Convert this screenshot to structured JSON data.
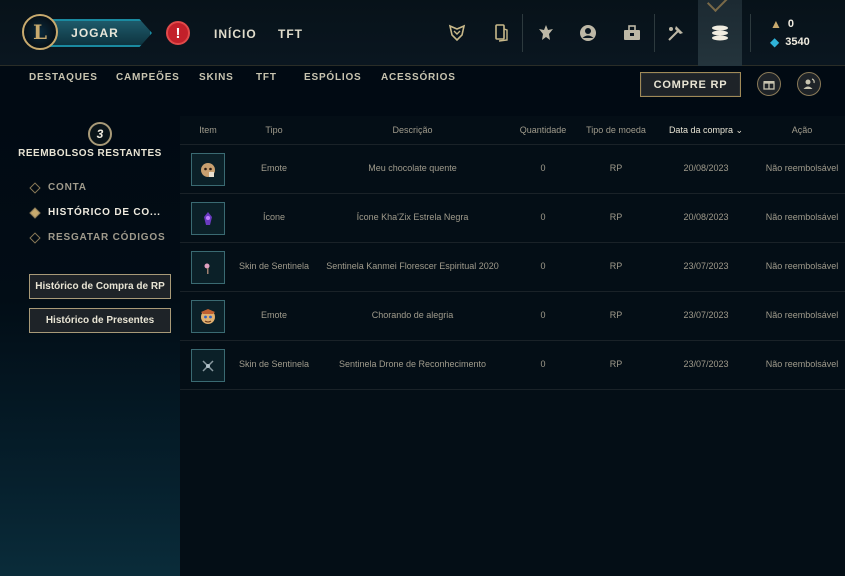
{
  "topbar": {
    "logo_letter": "L",
    "play_label": "JOGAR",
    "alert_glyph": "!",
    "nav": [
      "INÍCIO",
      "TFT"
    ],
    "icons": [
      "trophy-icon",
      "clash-icon",
      "champion-icon",
      "profile-icon",
      "collection-icon",
      "loot-icon",
      "store-icon"
    ],
    "currency": {
      "blue_essence": "0",
      "rp": "3540"
    }
  },
  "subnav": {
    "items": [
      "DESTAQUES",
      "CAMPEÕES",
      "SKINS",
      "TFT",
      "ESPÓLIOS",
      "ACESSÓRIOS"
    ],
    "buy_rp": "COMPRE RP"
  },
  "sidebar": {
    "refunds_count": "3",
    "refunds_label": "REEMBOLSOS RESTANTES",
    "items": [
      "CONTA",
      "HISTÓRICO DE CO...",
      "RESGATAR CÓDIGOS"
    ],
    "buttons": [
      "Histórico de Compra de RP",
      "Histórico de Presentes"
    ]
  },
  "table": {
    "headers": [
      "Item",
      "Tipo",
      "Descrição",
      "Quantidade",
      "Tipo de moeda",
      "Data da compra",
      "Ação"
    ],
    "rows": [
      {
        "icon": "emote-icon",
        "tipo": "Emote",
        "descricao": "Meu chocolate quente",
        "quantidade": "0",
        "moeda": "RP",
        "data": "20/08/2023",
        "acao": "Não reembolsável"
      },
      {
        "icon": "summoner-icon",
        "tipo": "Ícone",
        "descricao": "Ícone Kha'Zix Estrela Negra",
        "quantidade": "0",
        "moeda": "RP",
        "data": "20/08/2023",
        "acao": "Não reembolsável"
      },
      {
        "icon": "ward-skin-icon",
        "tipo": "Skin de Sentinela",
        "descricao": "Sentinela Kanmei Florescer Espiritual 2020",
        "quantidade": "0",
        "moeda": "RP",
        "data": "23/07/2023",
        "acao": "Não reembolsável"
      },
      {
        "icon": "emote-icon",
        "tipo": "Emote",
        "descricao": "Chorando de alegria",
        "quantidade": "0",
        "moeda": "RP",
        "data": "23/07/2023",
        "acao": "Não reembolsável"
      },
      {
        "icon": "ward-skin-icon",
        "tipo": "Skin de Sentinela",
        "descricao": "Sentinela Drone de Reconhecimento",
        "quantidade": "0",
        "moeda": "RP",
        "data": "23/07/2023",
        "acao": "Não reembolsável"
      }
    ]
  },
  "colors": {
    "gold": "#c8aa6e",
    "teal": "#1a8aa0",
    "background": "#010a13",
    "alert": "#c2202a"
  }
}
